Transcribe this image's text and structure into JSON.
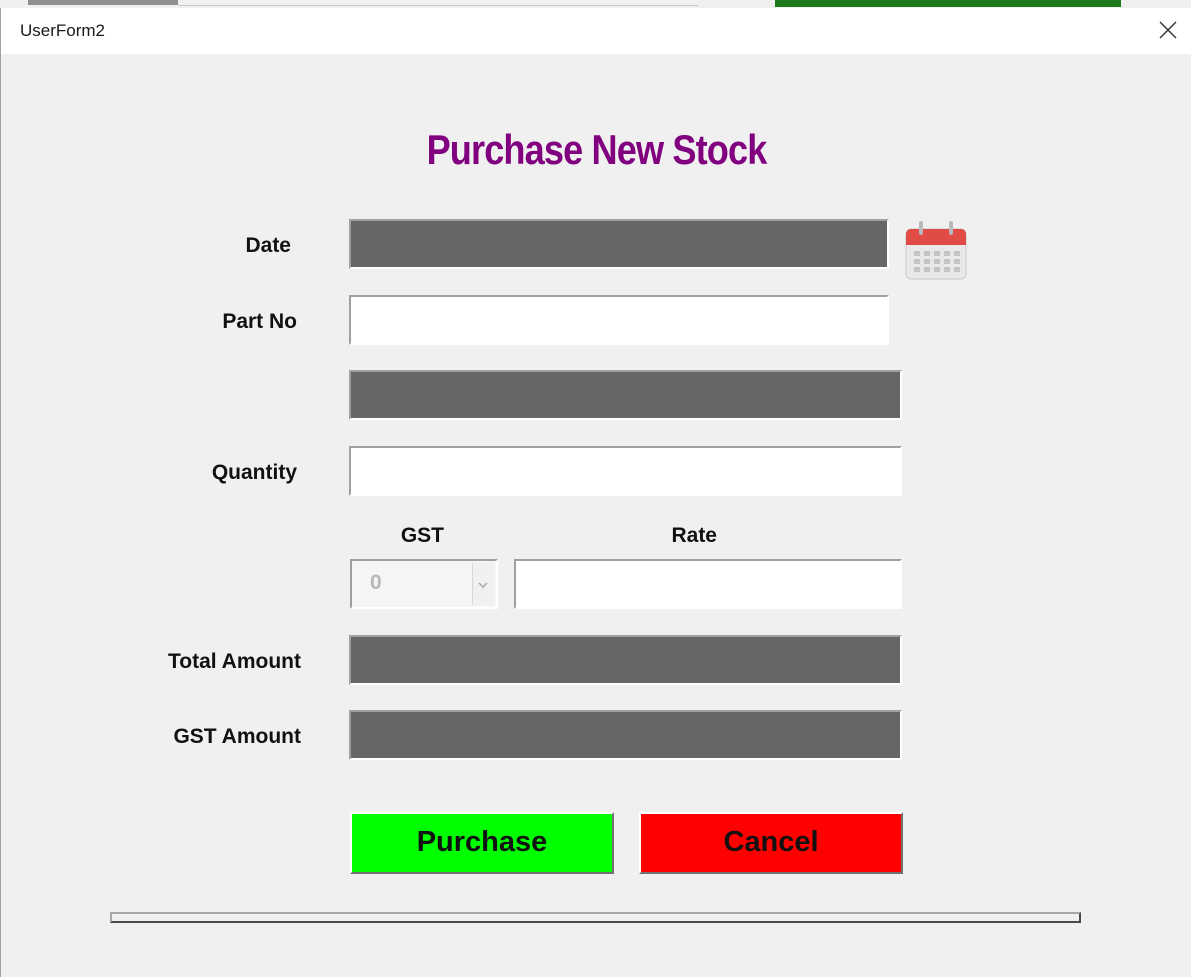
{
  "window": {
    "title": "UserForm2"
  },
  "form": {
    "heading": "Purchase New Stock",
    "labels": {
      "date": "Date",
      "part_no": "Part No",
      "quantity": "Quantity",
      "gst": "GST",
      "rate": "Rate",
      "total_amount": "Total Amount",
      "gst_amount": "GST Amount"
    },
    "fields": {
      "date": "",
      "part_no": "",
      "description": "",
      "quantity": "",
      "gst_selected": "0",
      "rate": "",
      "total_amount": "",
      "gst_amount": ""
    },
    "buttons": {
      "purchase": "Purchase",
      "cancel": "Cancel"
    },
    "progress": 0
  },
  "icons": {
    "close": "close-icon",
    "calendar": "calendar-icon",
    "dropdown": "chevron-down-icon"
  },
  "colors": {
    "heading": "#800080",
    "purchase_button": "#00ff00",
    "cancel_button": "#ff0000",
    "readonly_field": "#666666"
  }
}
